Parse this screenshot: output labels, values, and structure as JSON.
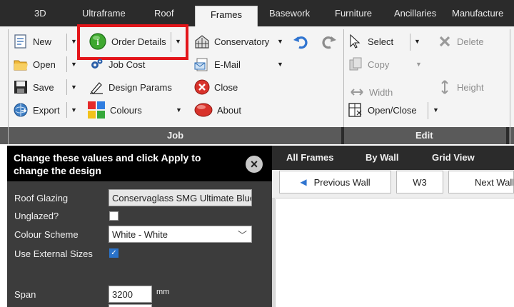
{
  "tabs": [
    "3D",
    "Ultraframe",
    "Roof",
    "Frames",
    "Basework",
    "Furniture",
    "Ancillaries",
    "Manufacture"
  ],
  "ribbon": {
    "job": {
      "new": "New",
      "open": "Open",
      "save": "Save",
      "export": "Export",
      "order_details": "Order Details",
      "job_cost": "Job Cost",
      "design_params": "Design Params",
      "colours": "Colours",
      "conservatory": "Conservatory",
      "email": "E-Mail",
      "close": "Close",
      "about": "About",
      "group_label": "Job"
    },
    "edit": {
      "select": "Select",
      "delete": "Delete",
      "copy": "Copy",
      "width": "Width",
      "height": "Height",
      "open_close": "Open/Close",
      "group_label": "Edit"
    }
  },
  "left_panel": {
    "header": "Change these values and click Apply to change the design",
    "fields": {
      "roof_glazing_label": "Roof Glazing",
      "roof_glazing_value": "Conservaglass SMG Ultimate Blue",
      "unglazed_label": "Unglazed?",
      "unglazed_checked": false,
      "colour_scheme_label": "Colour Scheme",
      "colour_scheme_value": "White - White",
      "use_external_sizes_label": "Use External Sizes",
      "use_external_sizes_checked": true,
      "span_label": "Span",
      "span_value": "3200",
      "span_unit": "mm"
    }
  },
  "right_panel": {
    "tabs": [
      "All Frames",
      "By Wall",
      "Grid View"
    ],
    "previous_wall": "Previous Wall",
    "wall_id": "W3",
    "next_wall": "Next Wall"
  },
  "colors": {
    "highlight": "#e3151a",
    "dark_bar": "#2b2b2b",
    "panel_bg": "#3c3c3c",
    "check_blue": "#2a72c8"
  }
}
